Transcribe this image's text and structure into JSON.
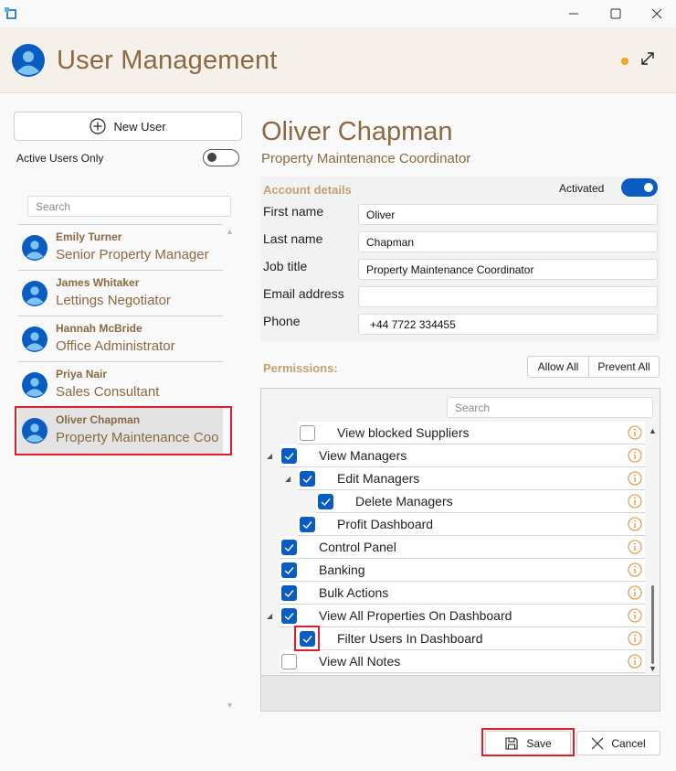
{
  "window": {
    "minimize_glyph": "—",
    "maximize_glyph": "☐",
    "close_glyph": "✕"
  },
  "header": {
    "title": "User Management",
    "status_color": "#f5a623"
  },
  "sidebar": {
    "new_user_label": "New User",
    "active_only_label": "Active Users Only",
    "search_placeholder": "Search",
    "users": [
      {
        "name": "Emily Turner",
        "role": "Senior Property Manager"
      },
      {
        "name": "James Whitaker",
        "role": "Lettings Negotiator"
      },
      {
        "name": "Hannah McBride",
        "role": "Office Administrator"
      },
      {
        "name": "Priya Nair",
        "role": "Sales Consultant"
      },
      {
        "name": "Oliver Chapman",
        "role": "Property Maintenance Coo"
      }
    ]
  },
  "detail": {
    "name": "Oliver Chapman",
    "role": "Property Maintenance Coordinator",
    "account_title": "Account details",
    "activated_label": "Activated",
    "fields": [
      {
        "label": "First name",
        "value": "Oliver"
      },
      {
        "label": "Last name",
        "value": "Chapman"
      },
      {
        "label": "Job title",
        "value": "Property Maintenance Coordinator"
      },
      {
        "label": "Email address",
        "value": ""
      },
      {
        "label": "Phone",
        "value": "+44 7722 334455"
      }
    ]
  },
  "permissions": {
    "title": "Permissions:",
    "allow_all_label": "Allow All",
    "prevent_all_label": "Prevent All",
    "search_placeholder": "Search",
    "items": [
      {
        "label": "View blocked Suppliers",
        "checked": false
      },
      {
        "label": "View Managers",
        "checked": true
      },
      {
        "label": "Edit Managers",
        "checked": true
      },
      {
        "label": "Delete Managers",
        "checked": true
      },
      {
        "label": "Profit Dashboard",
        "checked": true
      },
      {
        "label": "Control Panel",
        "checked": true
      },
      {
        "label": "Banking",
        "checked": true
      },
      {
        "label": "Bulk Actions",
        "checked": true
      },
      {
        "label": "View All Properties On Dashboard",
        "checked": true
      },
      {
        "label": "Filter Users In Dashboard",
        "checked": true
      },
      {
        "label": "View All Notes",
        "checked": false
      }
    ],
    "info_color": "#e8923a"
  },
  "actions": {
    "save_label": "Save",
    "cancel_label": "Cancel"
  },
  "colors": {
    "accent": "#0a5cc2",
    "brand_text": "#8b6a43",
    "section_title": "#c4a173",
    "highlight": "#e01e2b"
  }
}
